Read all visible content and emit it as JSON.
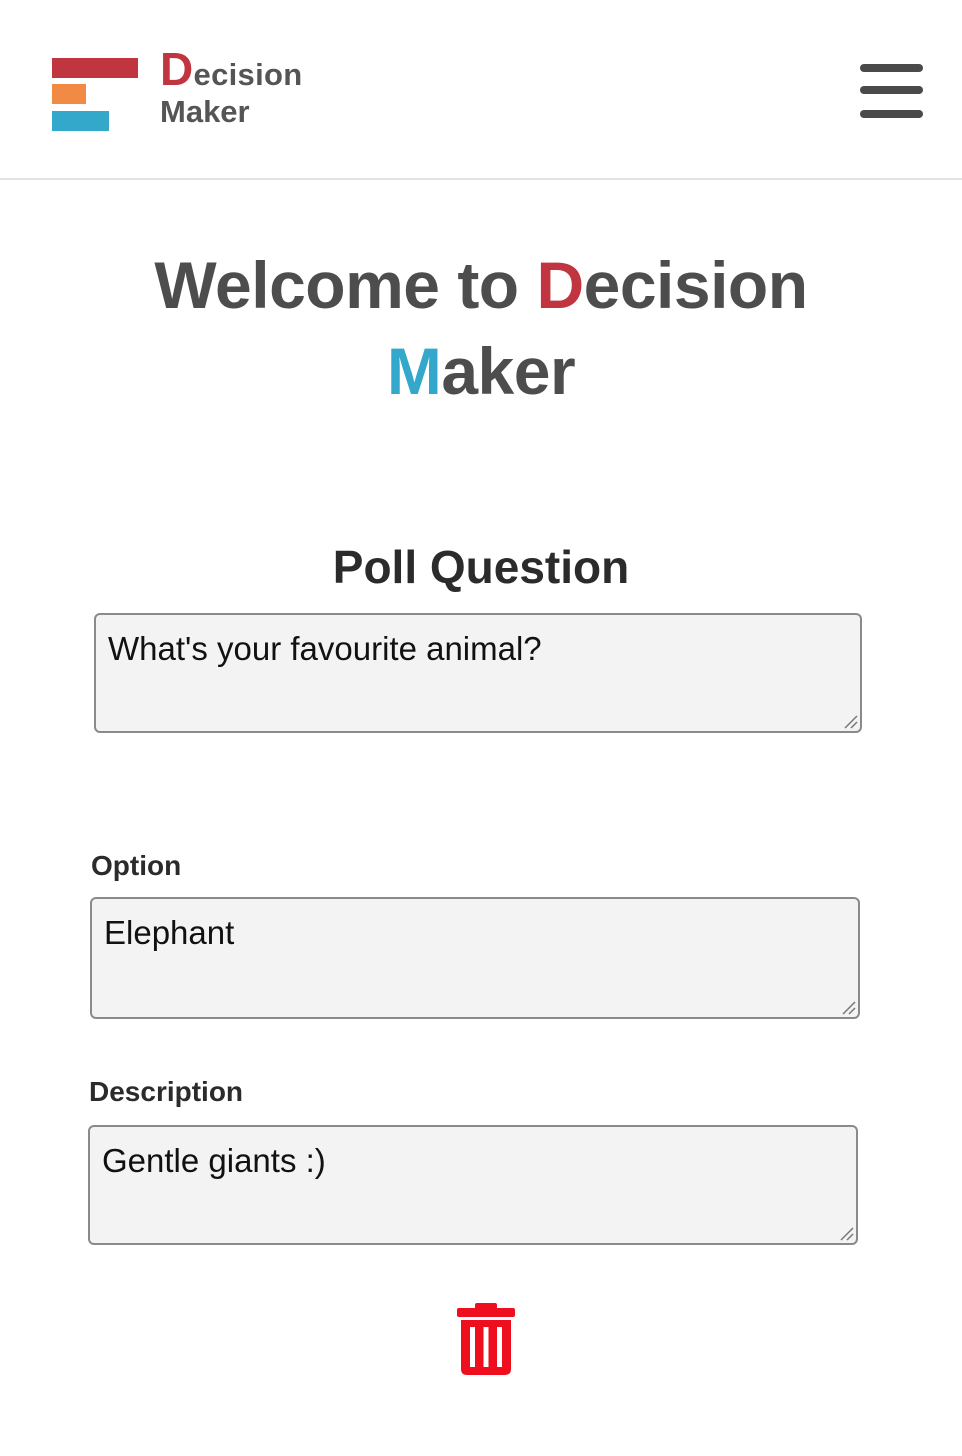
{
  "header": {
    "logo_cap": "D",
    "logo_rest": "ecision",
    "logo_line2": "Maker",
    "colors": {
      "red": "#c0353f",
      "orange": "#f18a45",
      "blue": "#33a8cb"
    },
    "menu_icon": "hamburger-menu-icon"
  },
  "welcome": {
    "prefix": "Welcome to ",
    "d_letter": "D",
    "d_rest": "ecision",
    "m_letter": "M",
    "m_rest": "aker"
  },
  "poll": {
    "heading": "Poll Question",
    "question_value": "What's your favourite animal?"
  },
  "option": {
    "label": "Option",
    "value": "Elephant"
  },
  "description": {
    "label": "Description",
    "value": "Gentle giants :)"
  },
  "actions": {
    "delete_icon": "trash-icon",
    "delete_color": "#ee0e1e"
  }
}
